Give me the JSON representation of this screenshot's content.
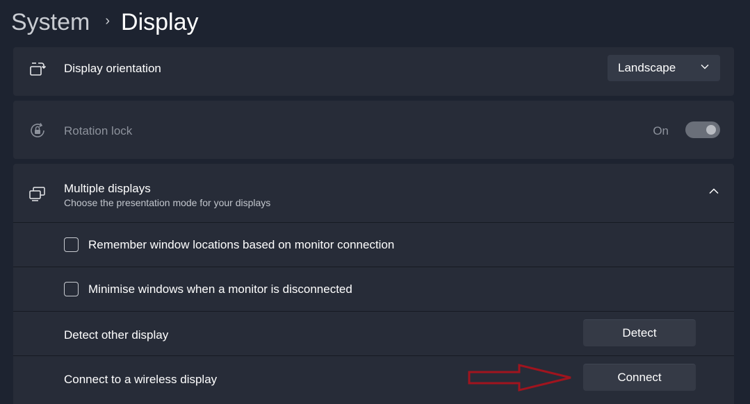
{
  "header": {
    "parent": "System",
    "separator": "›",
    "current": "Display"
  },
  "orientation": {
    "label": "Display orientation",
    "value": "Landscape",
    "icon": "rotate-screen-icon"
  },
  "rotation_lock": {
    "label": "Rotation lock",
    "state": "On",
    "on": true,
    "icon": "rotation-lock-icon"
  },
  "multiple_displays": {
    "title": "Multiple displays",
    "subtitle": "Choose the presentation mode for your displays",
    "icon": "multiple-displays-icon",
    "expanded": true,
    "options": [
      {
        "label": "Remember window locations based on monitor connection",
        "checked": false
      },
      {
        "label": "Minimise windows when a monitor is disconnected",
        "checked": false
      }
    ],
    "detect": {
      "label": "Detect other display",
      "button": "Detect"
    },
    "connect": {
      "label": "Connect to a wireless display",
      "button": "Connect"
    }
  },
  "annotation": {
    "color": "#a0141e",
    "icon": "red-arrow-annotation"
  }
}
